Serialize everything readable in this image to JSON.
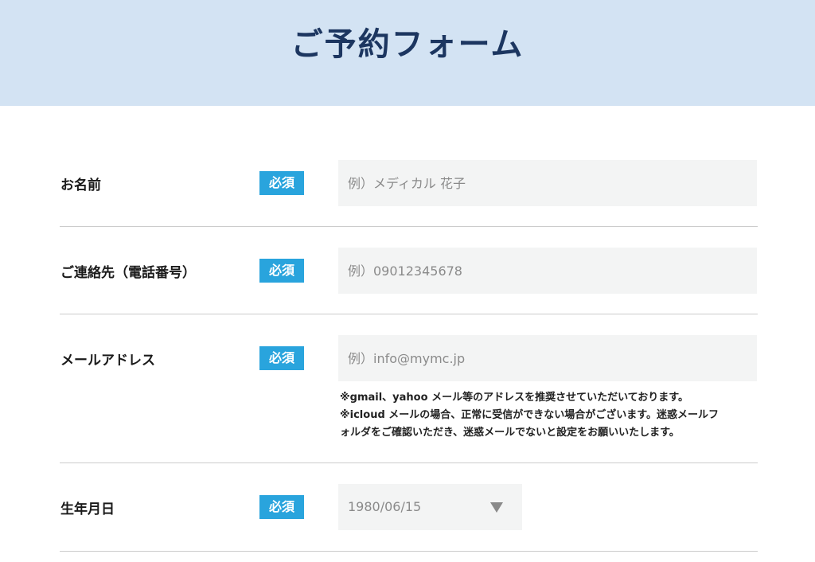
{
  "header": {
    "title": "ご予約フォーム"
  },
  "form": {
    "required_label": "必須",
    "name": {
      "label": "お名前",
      "placeholder": "例）メディカル 花子"
    },
    "phone": {
      "label": "ご連絡先（電話番号）",
      "placeholder": "例）09012345678"
    },
    "email": {
      "label": "メールアドレス",
      "placeholder": "例）info@mymc.jp",
      "notes": [
        "※gmail、yahoo メール等のアドレスを推奨させていただいております。",
        "※icloud メールの場合、正常に受信ができない場合がございます。迷惑メールフ",
        "ォルダをご確認いただき、迷惑メールでないと設定をお願いいたします。"
      ]
    },
    "birthdate": {
      "label": "生年月日",
      "value": "1980/06/15",
      "arrow_icon": "triangle-down-icon"
    }
  },
  "colors": {
    "header_bg": "#d3e3f3",
    "title": "#1c3660",
    "badge": "#29a4dd",
    "input_bg": "#f3f4f4"
  }
}
